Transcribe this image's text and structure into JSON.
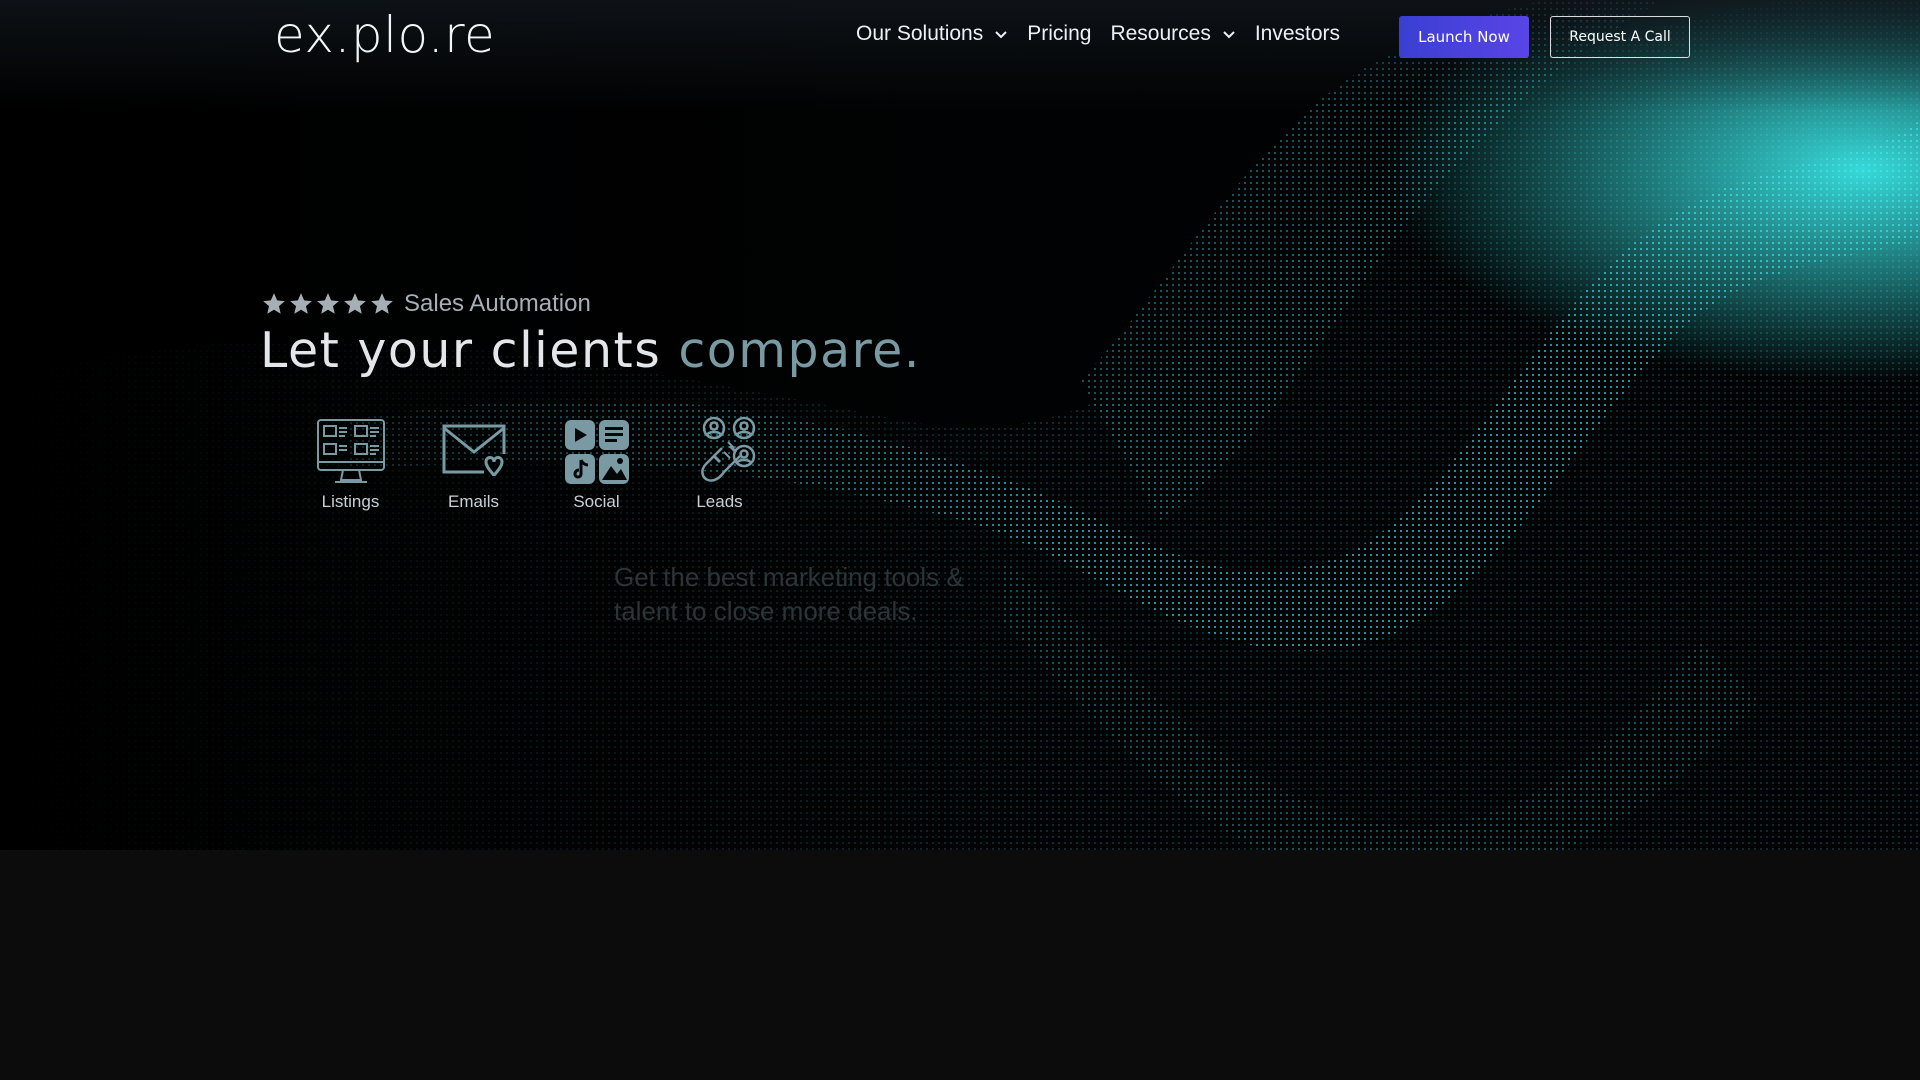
{
  "brand": {
    "logo": "ex.plo.re"
  },
  "nav": {
    "items": [
      {
        "label": "Our Solutions",
        "dropdown": true
      },
      {
        "label": "Pricing",
        "dropdown": false
      },
      {
        "label": "Resources",
        "dropdown": true
      },
      {
        "label": "Investors",
        "dropdown": false
      }
    ],
    "launch_label": "Launch Now",
    "call_label": "Request A Call"
  },
  "hero": {
    "rating_stars": 5,
    "tagline": "Sales Automation",
    "headline_main": "Let your clients ",
    "headline_accent": "compare.",
    "features": [
      {
        "label": "Listings",
        "icon": "listings-monitor-icon"
      },
      {
        "label": "Emails",
        "icon": "envelope-heart-icon"
      },
      {
        "label": "Social",
        "icon": "social-apps-icon"
      },
      {
        "label": "Leads",
        "icon": "magnet-leads-icon"
      }
    ],
    "subtext": "Get the best marketing tools & talent to close more deals."
  },
  "colors": {
    "accent": "#7a9aa3",
    "launch_button": "#4a42dc",
    "wave": "#1fb6c4",
    "background": "#010203"
  }
}
